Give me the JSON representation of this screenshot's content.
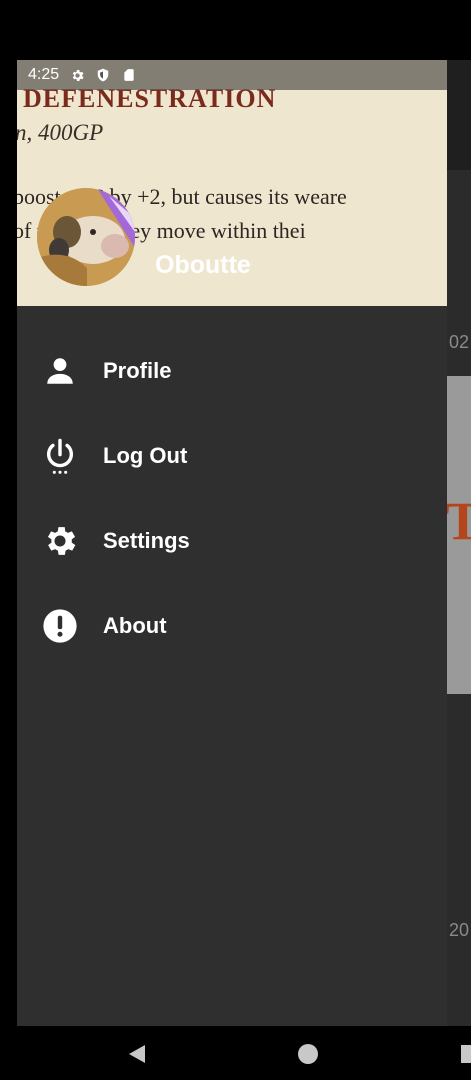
{
  "status_bar": {
    "time": "4:25",
    "icons": [
      "settings-gear-icon",
      "shield-icon",
      "sd-card-icon"
    ]
  },
  "header": {
    "background_text": {
      "title": "DEFENESTRATION",
      "subtitle": "n, 400GP",
      "line1": "boosts AC by +2, but causes its weare",
      "line2": "of window they move within thei"
    },
    "username": "Oboutte"
  },
  "menu": {
    "items": [
      {
        "label": "Profile",
        "icon": "person-icon"
      },
      {
        "label": "Log Out",
        "icon": "power-icon"
      },
      {
        "label": "Settings",
        "icon": "gear-icon"
      },
      {
        "label": "About",
        "icon": "info-alert-icon"
      }
    ]
  },
  "background_app": {
    "date_top": "02",
    "date_bottom": "20",
    "title_fragment": "Te"
  },
  "colors": {
    "drawer_bg": "#2f2f2f",
    "text": "#ffffff",
    "nav_bg": "#000000"
  },
  "navbar": {
    "buttons": [
      "back-icon",
      "home-icon",
      "recents-icon"
    ]
  }
}
